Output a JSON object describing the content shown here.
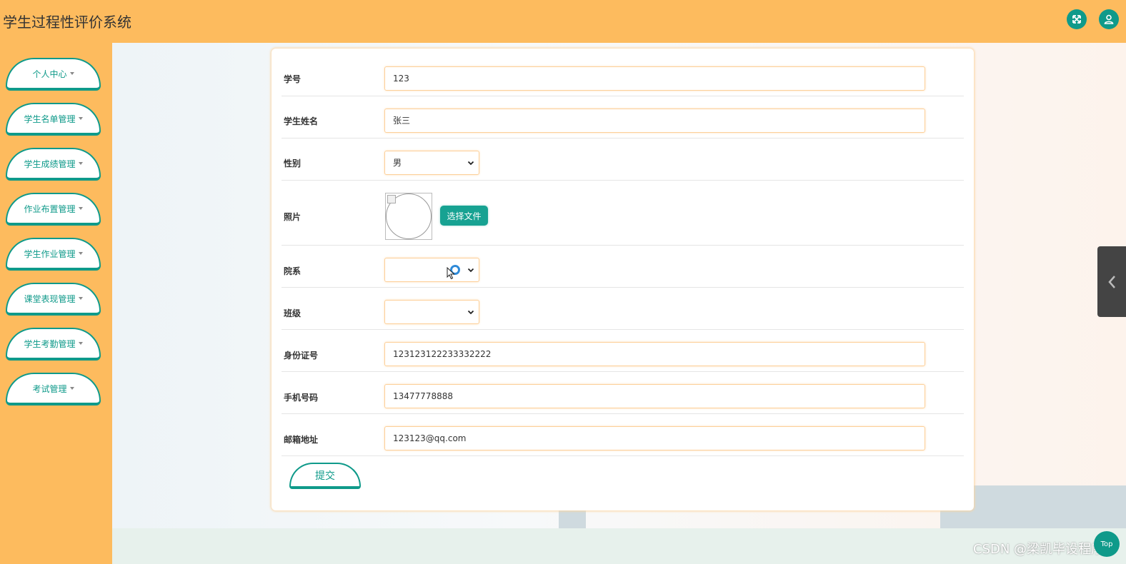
{
  "app": {
    "title": "学生过程性评价系统"
  },
  "header": {
    "fullscreen_icon": "expand-arrows-icon",
    "user_icon": "user-icon"
  },
  "sidebar": {
    "items": [
      {
        "label": "个人中心"
      },
      {
        "label": "学生名单管理"
      },
      {
        "label": "学生成绩管理"
      },
      {
        "label": "作业布置管理"
      },
      {
        "label": "学生作业管理"
      },
      {
        "label": "课堂表现管理"
      },
      {
        "label": "学生考勤管理"
      },
      {
        "label": "考试管理"
      }
    ]
  },
  "form": {
    "student_id": {
      "label": "学号",
      "value": "123"
    },
    "student_name": {
      "label": "学生姓名",
      "value": "张三"
    },
    "gender": {
      "label": "性别",
      "value": "男"
    },
    "photo": {
      "label": "照片",
      "button_label": "选择文件"
    },
    "department": {
      "label": "院系",
      "value": ""
    },
    "class": {
      "label": "班级",
      "value": ""
    },
    "id_card": {
      "label": "身份证号",
      "value": "123123122233332222"
    },
    "phone": {
      "label": "手机号码",
      "value": "13477778888"
    },
    "email": {
      "label": "邮箱地址",
      "value": "123123@qq.com"
    },
    "submit_label": "提交"
  },
  "floating": {
    "top_label": "Top",
    "side_tab_icon": "chevron-left-icon"
  },
  "watermark": "CSDN @梁凯毕设程序",
  "colors": {
    "header": "#fdbb5e",
    "accent": "#0f9a8a",
    "input_border": "#fdcf98"
  }
}
